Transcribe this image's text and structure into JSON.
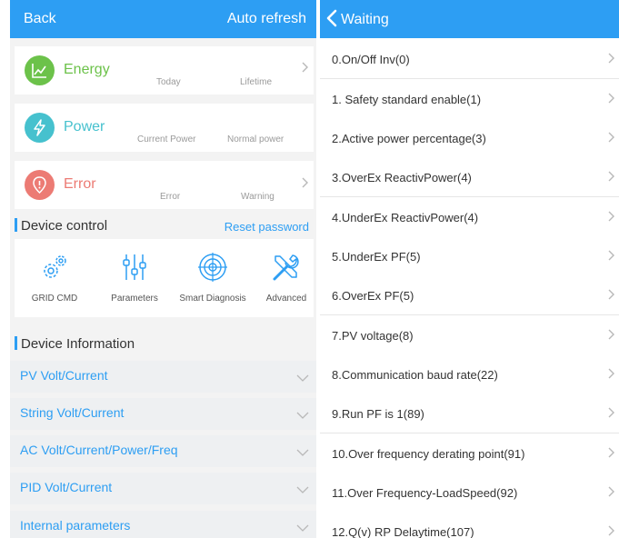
{
  "left": {
    "back_label": "Back",
    "auto_refresh_label": "Auto refresh",
    "energy": {
      "title": "Energy",
      "today_label": "Today",
      "lifetime_label": "Lifetime",
      "icon": "chart-icon",
      "color": "#6cc24a"
    },
    "power": {
      "title": "Power",
      "current_label": "Current Power",
      "normal_label": "Normal power",
      "icon": "lightning-icon",
      "color": "#46c1ce"
    },
    "error": {
      "title": "Error",
      "error_label": "Error",
      "warning_label": "Warning",
      "icon": "alert-icon",
      "color": "#ec7b74"
    },
    "device_control": {
      "title": "Device control",
      "reset_label": "Reset password"
    },
    "controls": [
      {
        "label": "GRID CMD",
        "icon": "gears-icon"
      },
      {
        "label": "Parameters",
        "icon": "sliders-icon"
      },
      {
        "label": "Smart Diagnosis",
        "icon": "radar-icon"
      },
      {
        "label": "Advanced",
        "icon": "tools-icon"
      }
    ],
    "device_information": {
      "title": "Device Information"
    },
    "info_rows": [
      {
        "label": "PV Volt/Current"
      },
      {
        "label": "String Volt/Current"
      },
      {
        "label": "AC Volt/Current/Power/Freq"
      },
      {
        "label": "PID Volt/Current"
      },
      {
        "label": "Internal parameters"
      }
    ]
  },
  "right": {
    "title": "Waiting",
    "items": [
      {
        "label": "0.On/Off Inv(0)"
      },
      {
        "label": "1. Safety standard enable(1)"
      },
      {
        "label": "2.Active power percentage(3)"
      },
      {
        "label": "3.OverEx ReactivPower(4)"
      },
      {
        "label": "4.UnderEx ReactivPower(4)"
      },
      {
        "label": "5.UnderEx PF(5)"
      },
      {
        "label": "6.OverEx PF(5)"
      },
      {
        "label": "7.PV voltage(8)"
      },
      {
        "label": "8.Communication baud rate(22)"
      },
      {
        "label": "9.Run PF is 1(89)"
      },
      {
        "label": "10.Over frequency derating point(91)"
      },
      {
        "label": "11.Over Frequency-LoadSpeed(92)"
      },
      {
        "label": "12.Q(v) RP Delaytime(107)"
      }
    ]
  },
  "colors": {
    "accent": "#2d9ef3",
    "background": "#f3f3f3",
    "row": "#eef0f2",
    "chevron": "#b8b8b8"
  }
}
